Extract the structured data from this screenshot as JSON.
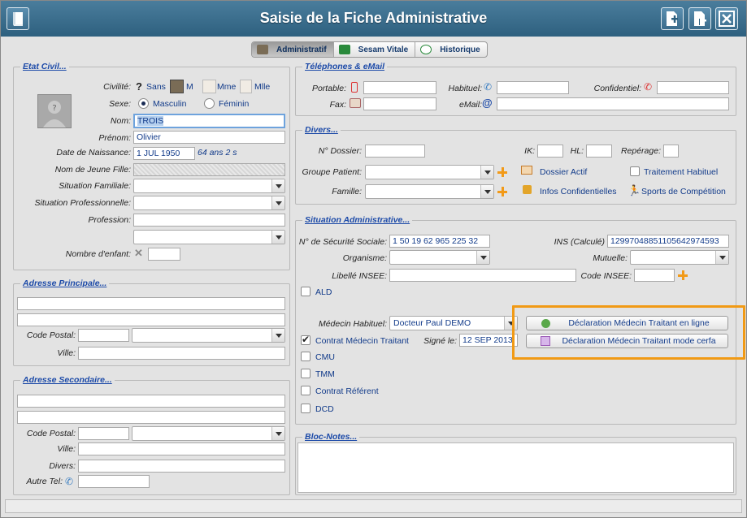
{
  "window": {
    "title": "Saisie de la Fiche Administrative"
  },
  "tabs": [
    {
      "label": "Administratif",
      "active": true
    },
    {
      "label": "Sesam Vitale",
      "active": false
    },
    {
      "label": "Historique",
      "active": false
    }
  ],
  "etat_civil": {
    "legend": "Etat Civil...",
    "civilite_label": "Civilité:",
    "civilite_options": [
      "Sans",
      "M",
      "Mme",
      "Mlle"
    ],
    "sexe_label": "Sexe:",
    "sexe_options": [
      "Masculin",
      "Féminin"
    ],
    "sexe_selected": "Masculin",
    "nom_label": "Nom:",
    "nom_value": "TROIS",
    "prenom_label": "Prénom:",
    "prenom_value": "Olivier",
    "naissance_label": "Date de Naissance:",
    "naissance_value": "1 JUL 1950",
    "age_text": "64 ans 2 s",
    "jeune_fille_label": "Nom de Jeune Fille:",
    "situation_familiale_label": "Situation Familiale:",
    "situation_pro_label": "Situation Professionnelle:",
    "profession_label": "Profession:",
    "enfants_label": "Nombre d'enfant:"
  },
  "adresse_principale": {
    "legend": "Adresse Principale...",
    "code_postal_label": "Code Postal:",
    "ville_label": "Ville:"
  },
  "adresse_secondaire": {
    "legend": "Adresse Secondaire...",
    "code_postal_label": "Code Postal:",
    "ville_label": "Ville:",
    "divers_label": "Divers:",
    "autre_tel_label": "Autre Tel:"
  },
  "telephones": {
    "legend": "Téléphones & eMail",
    "portable_label": "Portable:",
    "habituel_label": "Habituel:",
    "confidentiel_label": "Confidentiel:",
    "fax_label": "Fax:",
    "email_label": "eMail:"
  },
  "divers": {
    "legend": "Divers...",
    "dossier_label": "N° Dossier:",
    "ik_label": "IK:",
    "hl_label": "HL:",
    "reperage_label": "Repérage:",
    "groupe_label": "Groupe Patient:",
    "famille_label": "Famille:",
    "dossier_actif": "Dossier Actif",
    "traitement_habituel": "Traitement Habituel",
    "infos_confidentielles": "Infos Confidentielles",
    "sports_competition": "Sports de Compétition"
  },
  "situation_admin": {
    "legend": "Situation Administrative...",
    "secu_label": "N° de Sécurité Sociale:",
    "secu_value": "1 50 19 62 965 225 32",
    "ins_label": "INS (Calculé)",
    "ins_value": "12997048851105642974593",
    "organisme_label": "Organisme:",
    "mutuelle_label": "Mutuelle:",
    "libelle_insee_label": "Libellé INSEE:",
    "code_insee_label": "Code INSEE:",
    "ald_label": "ALD",
    "medecin_label": "Médecin Habituel:",
    "medecin_value": "Docteur Paul DEMO",
    "contrat_label": "Contrat Médecin Traitant",
    "signe_label": "Signé le:",
    "signe_value": "12 SEP 2013",
    "cmu_label": "CMU",
    "tmm_label": "TMM",
    "contrat_referent_label": "Contrat Référent",
    "dcd_label": "DCD",
    "btn_en_ligne": "Déclaration Médecin Traitant en ligne",
    "btn_cerfa": "Déclaration Médecin Traitant mode cerfa"
  },
  "bloc_notes": {
    "legend": "Bloc-Notes..."
  },
  "colors": {
    "title_bar": "#3b6c8c",
    "highlight": "#f19a15",
    "link_blue": "#1c4aa8"
  }
}
